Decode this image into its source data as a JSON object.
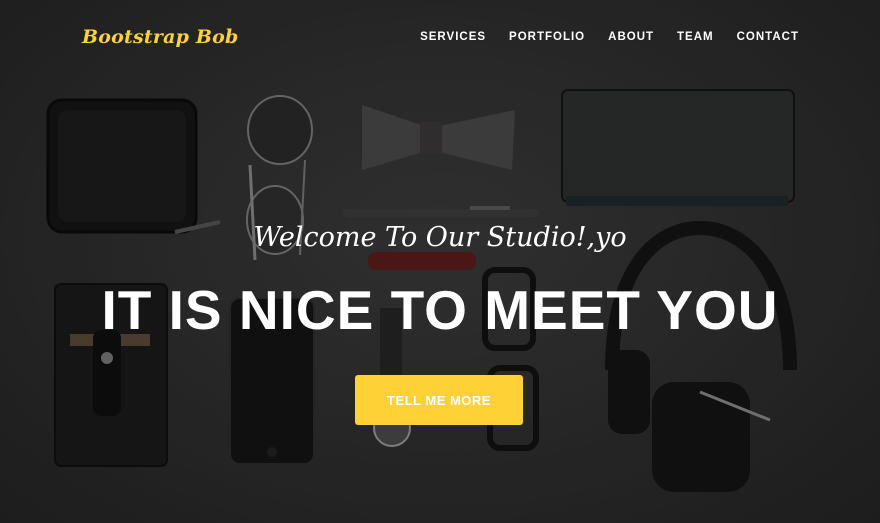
{
  "navbar": {
    "brand": "Bootstrap Bob",
    "items": [
      {
        "label": "SERVICES"
      },
      {
        "label": "PORTFOLIO"
      },
      {
        "label": "ABOUT"
      },
      {
        "label": "TEAM"
      },
      {
        "label": "CONTACT"
      }
    ]
  },
  "hero": {
    "lead": "Welcome To Our Studio!,yo",
    "heading": "IT IS NICE TO MEET YOU",
    "button_label": "TELL ME MORE",
    "background_image": "flat-lay-accessories-photo"
  },
  "colors": {
    "accent": "#fed136",
    "text": "#ffffff",
    "background": "#2c2c2c"
  }
}
